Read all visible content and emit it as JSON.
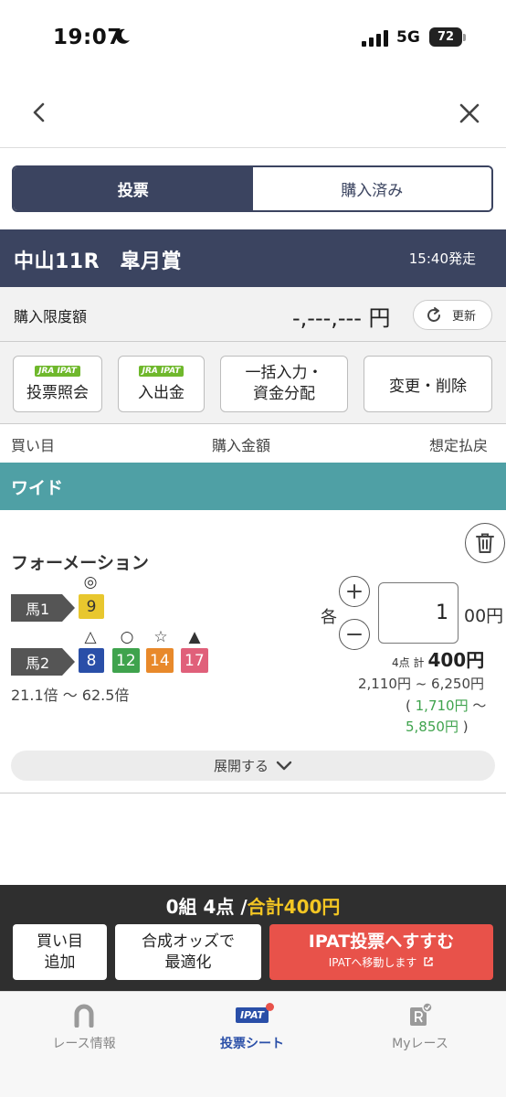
{
  "status": {
    "time": "19:07",
    "network": "5G",
    "battery": "72"
  },
  "tabs": {
    "vote": "投票",
    "purchased": "購入済み"
  },
  "race": {
    "name": "中山11R　皐月賞",
    "post_time": "15:40発走"
  },
  "limit": {
    "label": "購入限度額",
    "amount": "-,---,--- 円",
    "refresh": "更新"
  },
  "actions": {
    "jra_badge": "JRA IPAT",
    "inquiry": "投票照会",
    "deposit": "入出金",
    "bulk_line1": "一括入力・",
    "bulk_line2": "資金分配",
    "edit": "変更・削除"
  },
  "columns": {
    "bet": "買い目",
    "amount": "購入金額",
    "payout": "想定払戻"
  },
  "bet_type": "ワイド",
  "bet": {
    "method": "フォーメーション",
    "horse1_label": "馬1",
    "horse1_mark": "◎",
    "horse1_num": "9",
    "horse2_label": "馬2",
    "horse2": [
      {
        "mark": "△",
        "num": "8"
      },
      {
        "mark": "○",
        "num": "12"
      },
      {
        "mark": "☆",
        "num": "14"
      },
      {
        "mark": "▲",
        "num": "17"
      }
    ],
    "odds_range": "21.1倍 〜 62.5倍",
    "each_label": "各",
    "amount_value": "1",
    "amount_unit": "00円",
    "points_label": "4点 計",
    "total": "400円",
    "payout_range": "2,110円 ~ 6,250円",
    "payout_open": "(",
    "payout_alt_low": "1,710円",
    "payout_tilde": "〜",
    "payout_alt_high": "5,850円",
    "payout_close": ")"
  },
  "expand_label": "展開する",
  "summary": {
    "prefix": "0組 4点 /",
    "total": "合計400円",
    "add_line1": "買い目",
    "add_line2": "追加",
    "opt_line1": "合成オッズで",
    "opt_line2": "最適化",
    "ipat_main": "IPAT投票へすすむ",
    "ipat_sub": "IPATへ移動します"
  },
  "tabbar": {
    "race_info": "レース情報",
    "vote_sheet": "投票シート",
    "ipat_badge": "IPAT",
    "my_race": "Myレース"
  },
  "colors": {
    "navy": "#3b4460",
    "teal": "#4fa0a5",
    "num9": "#e8c72e",
    "num8": "#2a4fa8",
    "num12": "#3fa34d",
    "num14": "#e8892b",
    "num17": "#e0607a",
    "red": "#e8524a"
  }
}
